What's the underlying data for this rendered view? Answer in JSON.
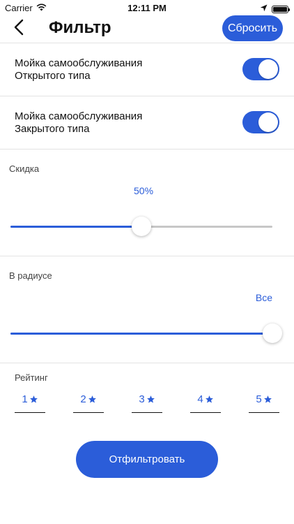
{
  "status_bar": {
    "carrier": "Carrier",
    "time": "12:11 PM",
    "icons": [
      "wifi-icon",
      "location-arrow-icon",
      "battery-icon"
    ]
  },
  "nav": {
    "back_icon": "chevron-left-icon",
    "title": "Фильтр",
    "reset_label": "Сбросить"
  },
  "toggles": [
    {
      "title": "Мойка самообслуживания",
      "subtitle": "Открытого типа",
      "on": true
    },
    {
      "title": "Мойка самообслуживания",
      "subtitle": "Закрытого типа",
      "on": true
    }
  ],
  "discount": {
    "label": "Скидка",
    "value_text": "50%",
    "fraction": 0.5
  },
  "radius": {
    "label": "В радиусе",
    "value_text": "Все",
    "fraction": 1.0
  },
  "rating": {
    "label": "Рейтинг",
    "options": [
      "1",
      "2",
      "3",
      "4",
      "5"
    ],
    "star_icon": "star-icon"
  },
  "filter_button_label": "Отфильтровать",
  "colors": {
    "accent": "#2b5dd9",
    "track": "#c7c7c7",
    "divider": "#e3e3e3"
  }
}
